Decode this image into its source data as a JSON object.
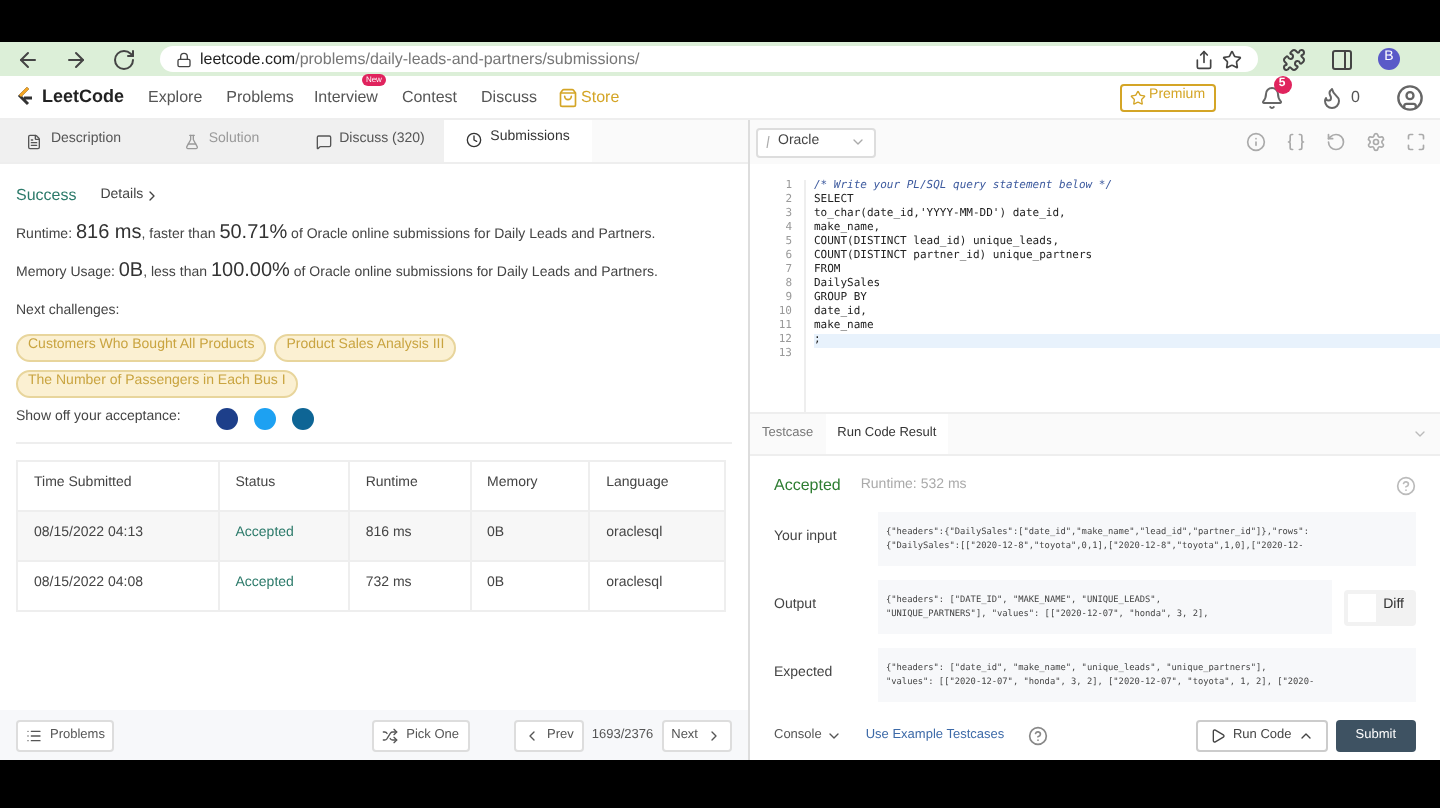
{
  "browser": {
    "url_host": "leetcode.com",
    "url_path": "/problems/daily-leads-and-partners/submissions/",
    "profile_initial": "B"
  },
  "nav": {
    "logo": "LeetCode",
    "items": [
      {
        "label": "Explore",
        "kind": "plain"
      },
      {
        "label": "Problems",
        "kind": "plain"
      },
      {
        "label": "Interview",
        "kind": "badge",
        "badge": "New"
      },
      {
        "label": "Contest",
        "kind": "plain"
      },
      {
        "label": "Discuss",
        "kind": "plain"
      },
      {
        "label": "Store",
        "kind": "store"
      }
    ],
    "premium": "Premium",
    "notifications": "5",
    "coins": "0"
  },
  "left_tabs": [
    {
      "label": "Description",
      "selected": false,
      "disabled": false
    },
    {
      "label": "Solution",
      "selected": false,
      "disabled": true
    },
    {
      "label": "Discuss (320)",
      "selected": false,
      "disabled": false
    },
    {
      "label": "Submissions",
      "selected": true,
      "disabled": false
    }
  ],
  "result": {
    "status": "Success",
    "details": "Details",
    "lines": [
      [
        {
          "text": "Runtime: ",
          "large": false
        },
        {
          "text": "816 ms",
          "large": true
        },
        {
          "text": ", faster than ",
          "large": false
        },
        {
          "text": "50.71%",
          "large": true
        },
        {
          "text": " of Oracle online submissions for Daily Leads and Partners.",
          "large": false
        }
      ],
      [
        {
          "text": "Memory Usage: ",
          "large": false
        },
        {
          "text": "0B",
          "large": true
        },
        {
          "text": ", less than ",
          "large": false
        },
        {
          "text": "100.00%",
          "large": true
        },
        {
          "text": " of Oracle online submissions for Daily Leads and Partners.",
          "large": false
        }
      ]
    ],
    "next_label": "Next challenges:",
    "challenges": [
      "Customers Who Bought All Products",
      "Product Sales Analysis III",
      "The Number of Passengers in Each Bus I"
    ],
    "share_label": "Show off your acceptance:"
  },
  "table": {
    "columns": [
      "Time Submitted",
      "Status",
      "Runtime",
      "Memory",
      "Language"
    ],
    "rows": [
      [
        "08/15/2022 04:13",
        "Accepted",
        "816 ms",
        "0B",
        "oraclesql"
      ],
      [
        "08/15/2022 04:08",
        "Accepted",
        "732 ms",
        "0B",
        "oraclesql"
      ]
    ]
  },
  "footer": {
    "problems": "Problems",
    "pick_one": "Pick One",
    "prev": "Prev",
    "page": "1693/2376",
    "next": "Next"
  },
  "editor": {
    "language": "Oracle",
    "lines": [
      {
        "n": "1",
        "text": "/* Write your PL/SQL query statement below */",
        "kind": "comment",
        "active": false
      },
      {
        "n": "2",
        "text": "SELECT",
        "kind": "code",
        "active": false
      },
      {
        "n": "3",
        "text": "to_char(date_id,'YYYY-MM-DD') date_id,",
        "kind": "code",
        "active": false
      },
      {
        "n": "4",
        "text": "make_name,",
        "kind": "code",
        "active": false
      },
      {
        "n": "5",
        "text": "COUNT(DISTINCT lead_id) unique_leads,",
        "kind": "code",
        "active": false
      },
      {
        "n": "6",
        "text": "COUNT(DISTINCT partner_id) unique_partners",
        "kind": "code",
        "active": false
      },
      {
        "n": "7",
        "text": "FROM",
        "kind": "code",
        "active": false
      },
      {
        "n": "8",
        "text": "DailySales",
        "kind": "code",
        "active": false
      },
      {
        "n": "9",
        "text": "GROUP BY",
        "kind": "code",
        "active": false
      },
      {
        "n": "10",
        "text": "date_id,",
        "kind": "code",
        "active": false
      },
      {
        "n": "11",
        "text": "make_name",
        "kind": "code",
        "active": false
      },
      {
        "n": "12",
        "text": ";",
        "kind": "code",
        "active": true
      },
      {
        "n": "13",
        "kind": "code",
        "active": false
      }
    ]
  },
  "console_tabs": [
    {
      "label": "Testcase",
      "selected": false
    },
    {
      "label": "Run Code Result",
      "selected": true
    }
  ],
  "run_result": {
    "status": "Accepted",
    "runtime": "Runtime: 532 ms",
    "fields": [
      {
        "label": "Your input",
        "lines": [
          "{\"headers\":{\"DailySales\":[\"date_id\",\"make_name\",\"lead_id\",\"partner_id\"]},\"rows\":",
          "{\"DailySales\":[[\"2020-12-8\",\"toyota\",0,1],[\"2020-12-8\",\"toyota\",1,0],[\"2020-12-"
        ]
      },
      {
        "label": "Output",
        "lines": [
          "{\"headers\": [\"DATE_ID\", \"MAKE_NAME\", \"UNIQUE_LEADS\",",
          "\"UNIQUE_PARTNERS\"], \"values\": [[\"2020-12-07\", \"honda\", 3, 2],"
        ]
      },
      {
        "label": "Expected",
        "lines": [
          "{\"headers\": [\"date_id\", \"make_name\", \"unique_leads\", \"unique_partners\"],",
          "\"values\": [[\"2020-12-07\", \"honda\", 3, 2], [\"2020-12-07\", \"toyota\", 1, 2], [\"2020-"
        ]
      }
    ],
    "diff": {
      "label": "Diff",
      "on": false
    }
  },
  "bottom": {
    "console": "Console",
    "examples": "Use Example Testcases",
    "run": "Run Code",
    "submit": "Submit"
  }
}
